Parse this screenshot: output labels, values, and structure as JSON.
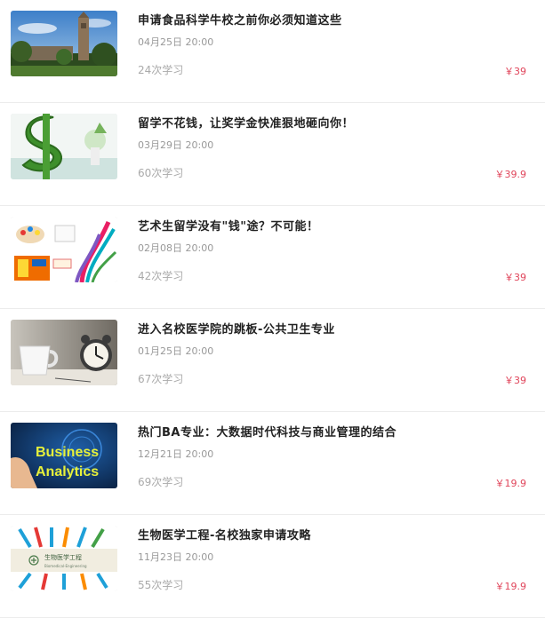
{
  "courses": [
    {
      "title": "申请食品科学牛校之前你必须知道这些",
      "date": "04月25日 20:00",
      "learners": "24次学习",
      "price": "￥39",
      "thumb_icon": "clock-tower-campus-image"
    },
    {
      "title": "留学不花钱，让奖学金快准狠地砸向你！",
      "date": "03月29日 20:00",
      "learners": "60次学习",
      "price": "￥39.9",
      "thumb_icon": "green-dollar-sign-image"
    },
    {
      "title": "艺术生留学没有\"钱\"途？不可能！",
      "date": "02月08日 20:00",
      "learners": "42次学习",
      "price": "￥39",
      "thumb_icon": "art-painting-image"
    },
    {
      "title": "进入名校医学院的跳板-公共卫生专业",
      "date": "01月25日 20:00",
      "learners": "67次学习",
      "price": "￥39",
      "thumb_icon": "alarm-clock-mug-image"
    },
    {
      "title": "热门BA专业：大数据时代科技与商业管理的结合",
      "date": "12月21日 20:00",
      "learners": "69次学习",
      "price": "￥19.9",
      "thumb_icon": "business-analytics-image",
      "thumb_text": [
        "Business",
        "Analytics"
      ]
    },
    {
      "title": "生物医学工程-名校独家申请攻略",
      "date": "11月23日 20:00",
      "learners": "55次学习",
      "price": "￥19.9",
      "thumb_icon": "biomedical-engineering-image",
      "thumb_text": [
        "生物医学工程",
        "Biomedical-Engineering"
      ]
    }
  ],
  "colors": {
    "price": "#e0445a",
    "title": "#222222",
    "meta": "#999999",
    "divider": "#ececec"
  }
}
